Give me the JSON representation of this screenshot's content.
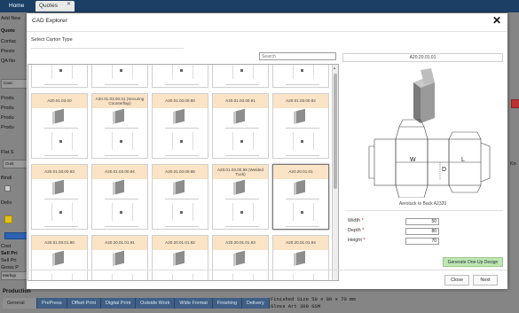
{
  "app": {
    "tabs": [
      {
        "label": "Home"
      },
      {
        "label": "Quotes"
      }
    ],
    "sidebar_labels": [
      "Add New",
      "Quote",
      "Contac",
      "Previo",
      "QA No",
      "Canc",
      "Produ",
      "Produ",
      "Produ",
      "Produ",
      "Flat S",
      "Cust",
      "Bindi",
      "Deliv",
      "Cost",
      "Sell Pri",
      "Sell Pri",
      "Gross P",
      "Markup"
    ],
    "bottom": {
      "title": "Production",
      "tabs": [
        "General",
        "PrePress",
        "Offset Print",
        "Digital Print",
        "Outside Work",
        "Wide Format",
        "Finishing",
        "Delivery"
      ],
      "note_line1": "Finished Size 50 x 80 x 70 mm",
      "note_line2": "Gloss Art 300 GSM"
    },
    "right_label": "Kn"
  },
  "modal": {
    "title": "CAD Explorer",
    "close_glyph": "✕",
    "section_label": "Select Carton Type",
    "search_placeholder": "Search",
    "grid": {
      "cards": [
        {
          "label": ""
        },
        {
          "label": ""
        },
        {
          "label": ""
        },
        {
          "label": ""
        },
        {
          "label": ""
        },
        {
          "label": "A20.01.03.00"
        },
        {
          "label": "A20.01.03.00.31 (Securing Counterflap)"
        },
        {
          "label": "A20.01.03.00.90"
        },
        {
          "label": "A20.01.03.00.91"
        },
        {
          "label": "A20.01.03.00.92"
        },
        {
          "label": "A20.01.03.00.93"
        },
        {
          "label": "A20.01.03.00.94"
        },
        {
          "label": "A20.01.03.00.95"
        },
        {
          "label": "A20.01.03.00.99 (Welded Tuck)"
        },
        {
          "label": "A20.20.01.01"
        },
        {
          "label": "A20.01.03.01.90"
        },
        {
          "label": "A20.20.01.01.91"
        },
        {
          "label": "A20.20.01.01.92"
        },
        {
          "label": "A20.20.01.01.93"
        },
        {
          "label": "A20.20.01.01.94"
        }
      ]
    },
    "preview": {
      "header": "A20.20.01.01",
      "dim_letters": {
        "w": "W",
        "l": "L",
        "d": "D"
      },
      "description": "Aerotuck to Back A2320"
    },
    "dimensions": [
      {
        "label": "Width",
        "required": "*",
        "value": "50"
      },
      {
        "label": "Depth",
        "required": "*",
        "value": "80"
      },
      {
        "label": "Height",
        "required": "*",
        "value": "70"
      }
    ],
    "generate_label": "Generate One-Up Design",
    "close_label": "Close",
    "next_label": "Next"
  }
}
